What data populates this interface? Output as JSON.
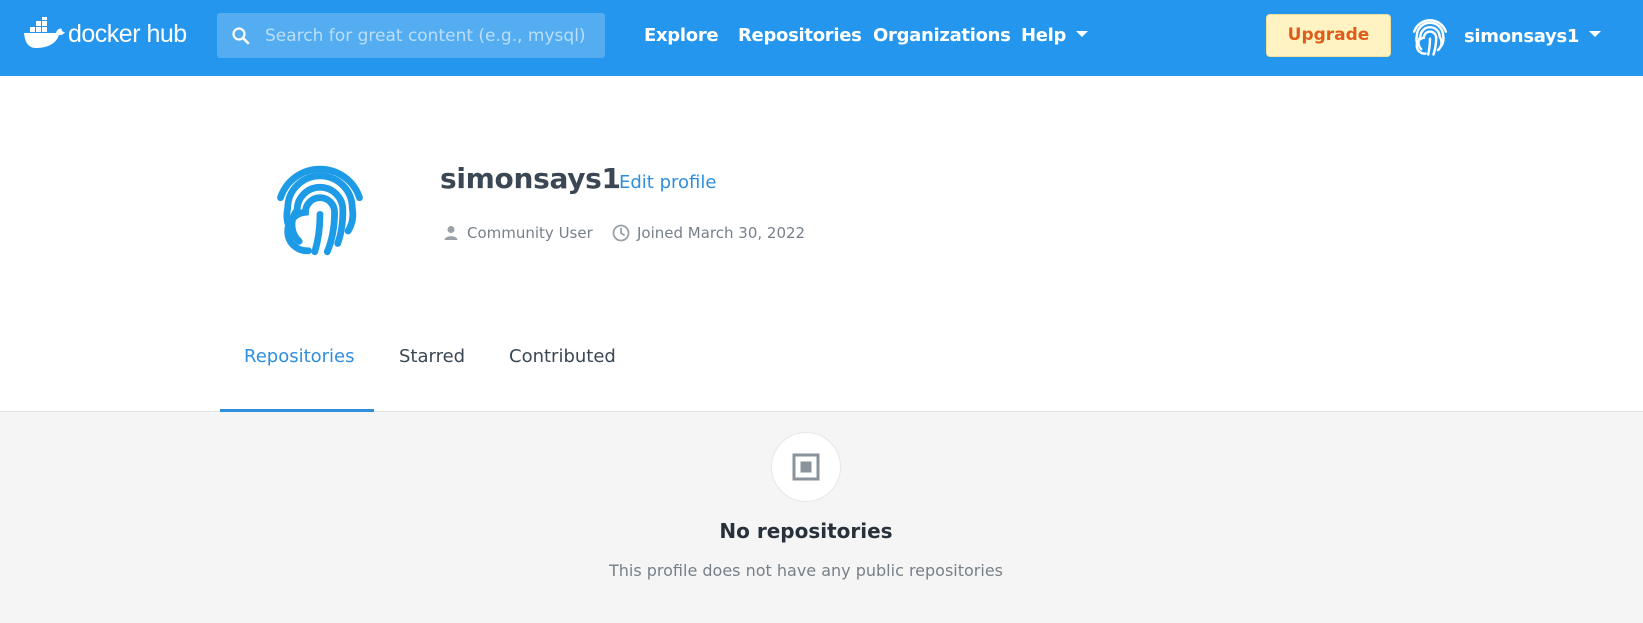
{
  "nav": {
    "logo_text": "docker hub",
    "search_placeholder": "Search for great content (e.g., mysql)",
    "links": [
      "Explore",
      "Repositories",
      "Organizations",
      "Help"
    ],
    "upgrade_label": "Upgrade",
    "username": "simonsays1",
    "accent_color": "#2496ed"
  },
  "profile": {
    "username": "simonsays1",
    "edit_label": "Edit profile",
    "user_type": "Community User",
    "joined": "Joined March 30, 2022"
  },
  "tabs": [
    {
      "label": "Repositories",
      "active": true
    },
    {
      "label": "Starred",
      "active": false
    },
    {
      "label": "Contributed",
      "active": false
    }
  ],
  "empty_state": {
    "title": "No repositories",
    "subtitle": "This profile does not have any public repositories"
  }
}
